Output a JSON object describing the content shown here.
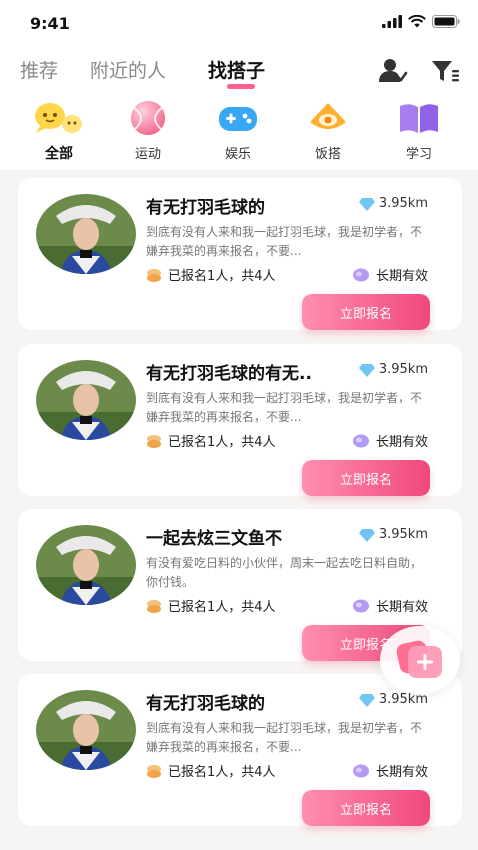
{
  "status_bar": {
    "time": "9:41"
  },
  "tabs": [
    {
      "label": "推荐"
    },
    {
      "label": "附近的人"
    },
    {
      "label": "找搭子"
    }
  ],
  "categories": [
    {
      "label": "全部",
      "icon": "chat-bubbles-icon"
    },
    {
      "label": "运动",
      "icon": "ball-icon"
    },
    {
      "label": "娱乐",
      "icon": "gamepad-icon"
    },
    {
      "label": "饭搭",
      "icon": "food-icon"
    },
    {
      "label": "学习",
      "icon": "book-icon"
    }
  ],
  "cards": [
    {
      "title": "有无打羽毛球的",
      "distance": "3.95km",
      "description": "到底有没有人来和我一起打羽毛球，我是初学者，不嫌弃我菜的再来报名，不要...",
      "joined": "已报名1人，共4人",
      "validity": "长期有效",
      "button": "立即报名"
    },
    {
      "title": "有无打羽毛球的有无..",
      "distance": "3.95km",
      "description": "到底有没有人来和我一起打羽毛球，我是初学者，不嫌弃我菜的再来报名，不要...",
      "joined": "已报名1人，共4人",
      "validity": "长期有效",
      "button": "立即报名"
    },
    {
      "title": "一起去炫三文鱼不",
      "distance": "3.95km",
      "description": "有没有爱吃日料的小伙伴，周末一起去吃日料自助，你付钱。",
      "joined": "已报名1人，共4人",
      "validity": "长期有效",
      "button": "立即报名"
    },
    {
      "title": "有无打羽毛球的",
      "distance": "3.95km",
      "description": "到底有没有人来和我一起打羽毛球，我是初学者，不嫌弃我菜的再来报名，不要...",
      "joined": "已报名1人，共4人",
      "validity": "长期有效",
      "button": "立即报名"
    }
  ],
  "colors": {
    "accent": "#ff5f8a",
    "button_start": "#ff8fb0",
    "button_end": "#f0487a",
    "list_background": "#f7f5f3"
  }
}
